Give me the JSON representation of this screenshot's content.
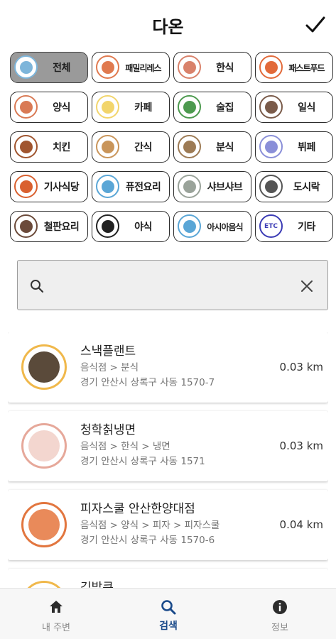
{
  "header": {
    "title": "다온"
  },
  "accent": "#1a4a8a",
  "categories": [
    {
      "label": "전체",
      "icon": "cloche-icon",
      "color": "#7db5da",
      "selected": true
    },
    {
      "label": "패밀리레스",
      "icon": "fork-knife-icon",
      "color": "#e07a4f"
    },
    {
      "label": "한식",
      "icon": "bowl-icon",
      "color": "#d9826b"
    },
    {
      "label": "패스트푸드",
      "icon": "burger-icon",
      "color": "#e26a3a"
    },
    {
      "label": "양식",
      "icon": "pasta-icon",
      "color": "#d97a55"
    },
    {
      "label": "카페",
      "icon": "coffee-icon",
      "color": "#f2d56c"
    },
    {
      "label": "술집",
      "icon": "drink-icon",
      "color": "#4d9a4f"
    },
    {
      "label": "일식",
      "icon": "sushi-icon",
      "color": "#7a5b4a"
    },
    {
      "label": "치킨",
      "icon": "chicken-icon",
      "color": "#a0552f"
    },
    {
      "label": "간식",
      "icon": "snack-icon",
      "color": "#c9955a"
    },
    {
      "label": "분식",
      "icon": "tteokbokki-icon",
      "color": "#9d7b55"
    },
    {
      "label": "뷔페",
      "icon": "buffet-icon",
      "color": "#8a8fd8"
    },
    {
      "label": "기사식당",
      "icon": "tray-icon",
      "color": "#d9602f"
    },
    {
      "label": "퓨전요리",
      "icon": "plate-icon",
      "color": "#5aa6d6"
    },
    {
      "label": "샤브샤브",
      "icon": "hotpot-icon",
      "color": "#9aa39a"
    },
    {
      "label": "도시락",
      "icon": "lunchbox-icon",
      "color": "#555555"
    },
    {
      "label": "철판요리",
      "icon": "grill-icon",
      "color": "#6b4a3a"
    },
    {
      "label": "야식",
      "icon": "moon-icon",
      "color": "#222222"
    },
    {
      "label": "아시아음식",
      "icon": "asian-plate-icon",
      "color": "#5aa6d6"
    },
    {
      "label": "기타",
      "icon": "etc-icon",
      "color": "#3b3bb5",
      "text": "ETC"
    }
  ],
  "search": {
    "placeholder": "",
    "value": ""
  },
  "results": [
    {
      "name": "스낵플랜트",
      "category": "음식점 > 분식",
      "address": "경기 안산시 상록구 사동 1570-7",
      "distance": "0.03 km",
      "icon": "snack-food-icon",
      "ring": "#f0b84b",
      "fill": "#5a4a3a"
    },
    {
      "name": "청학칡냉면",
      "category": "음식점 > 한식 > 냉면",
      "address": "경기 안산시 상록구 사동 1571",
      "distance": "0.03 km",
      "icon": "rice-bowl-icon",
      "ring": "#e6a89a",
      "fill": "#f3d6cf"
    },
    {
      "name": "피자스쿨 안산한양대점",
      "category": "음식점 > 양식 > 피자 > 피자스쿨",
      "address": "경기 안산시 상록구 사동 1570-6",
      "distance": "0.04 km",
      "icon": "pasta-plate-icon",
      "ring": "#e2763f",
      "fill": "#e98a5a"
    },
    {
      "name": "김밥큐",
      "category": "",
      "address": "",
      "distance": "",
      "icon": "gimbap-icon",
      "ring": "#f0b84b",
      "fill": "#f6e2a8"
    }
  ],
  "nav": [
    {
      "label": "내 주변",
      "icon": "home-icon"
    },
    {
      "label": "검색",
      "icon": "search-icon",
      "active": true
    },
    {
      "label": "정보",
      "icon": "info-icon"
    }
  ]
}
